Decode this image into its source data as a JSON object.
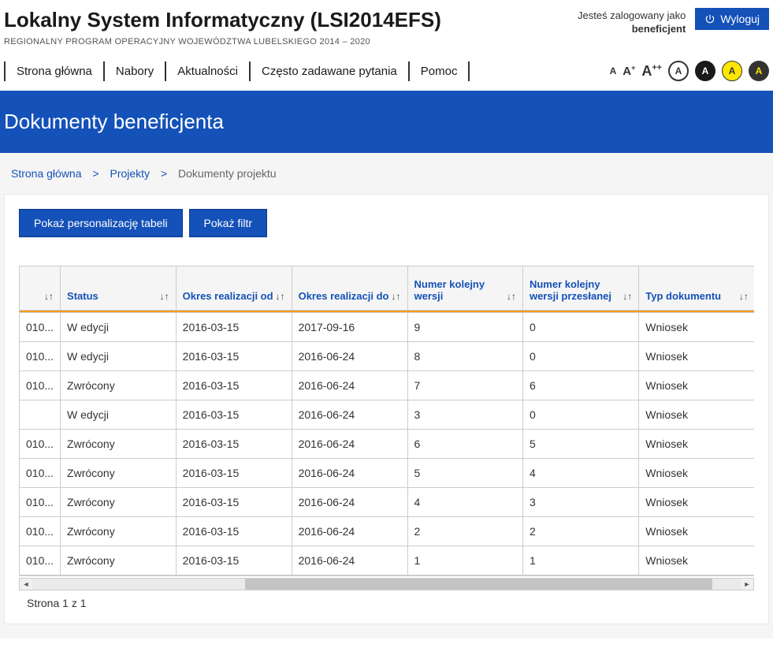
{
  "header": {
    "title": "Lokalny System Informatyczny (LSI2014EFS)",
    "subtitle": "REGIONALNY PROGRAM OPERACYJNY WOJEWÓDZTWA LUBELSKIEGO 2014 – 2020",
    "login_text": "Jesteś zalogowany jako",
    "login_role": "beneficjent",
    "logout_label": "Wyloguj"
  },
  "nav": {
    "items": [
      "Strona główna",
      "Nabory",
      "Aktualności",
      "Często zadawane pytania",
      "Pomoc"
    ]
  },
  "accessibility": {
    "font_small": "A",
    "font_medium": "A+",
    "font_large": "A++",
    "contrast_letter": "A"
  },
  "page_title": "Dokumenty beneficjenta",
  "breadcrumb": {
    "home": "Strona główna",
    "mid": "Projekty",
    "current": "Dokumenty projektu",
    "sep": ">"
  },
  "buttons": {
    "personalize": "Pokaż personalizację tabeli",
    "filter": "Pokaż filtr"
  },
  "table": {
    "columns": {
      "c0": "",
      "c1": "Status",
      "c2": "Okres realizacji od",
      "c3": "Okres realizacji do",
      "c4": "Numer kolejny wersji",
      "c5": "Numer kolejny wersji przesłanej",
      "c6": "Typ dokumentu"
    },
    "rows": [
      {
        "c0": "010...",
        "c1": "W edycji",
        "c2": "2016-03-15",
        "c3": "2017-09-16",
        "c4": "9",
        "c5": "0",
        "c6": "Wniosek"
      },
      {
        "c0": "010...",
        "c1": "W edycji",
        "c2": "2016-03-15",
        "c3": "2016-06-24",
        "c4": "8",
        "c5": "0",
        "c6": "Wniosek"
      },
      {
        "c0": "010...",
        "c1": "Zwrócony",
        "c2": "2016-03-15",
        "c3": "2016-06-24",
        "c4": "7",
        "c5": "6",
        "c6": "Wniosek"
      },
      {
        "c0": "",
        "c1": "W edycji",
        "c2": "2016-03-15",
        "c3": "2016-06-24",
        "c4": "3",
        "c5": "0",
        "c6": "Wniosek"
      },
      {
        "c0": "010...",
        "c1": "Zwrócony",
        "c2": "2016-03-15",
        "c3": "2016-06-24",
        "c4": "6",
        "c5": "5",
        "c6": "Wniosek"
      },
      {
        "c0": "010...",
        "c1": "Zwrócony",
        "c2": "2016-03-15",
        "c3": "2016-06-24",
        "c4": "5",
        "c5": "4",
        "c6": "Wniosek"
      },
      {
        "c0": "010...",
        "c1": "Zwrócony",
        "c2": "2016-03-15",
        "c3": "2016-06-24",
        "c4": "4",
        "c5": "3",
        "c6": "Wniosek"
      },
      {
        "c0": "010...",
        "c1": "Zwrócony",
        "c2": "2016-03-15",
        "c3": "2016-06-24",
        "c4": "2",
        "c5": "2",
        "c6": "Wniosek"
      },
      {
        "c0": "010...",
        "c1": "Zwrócony",
        "c2": "2016-03-15",
        "c3": "2016-06-24",
        "c4": "1",
        "c5": "1",
        "c6": "Wniosek"
      }
    ]
  },
  "pager": {
    "text": "Strona 1 z 1"
  },
  "sort_glyph": "↓↑"
}
